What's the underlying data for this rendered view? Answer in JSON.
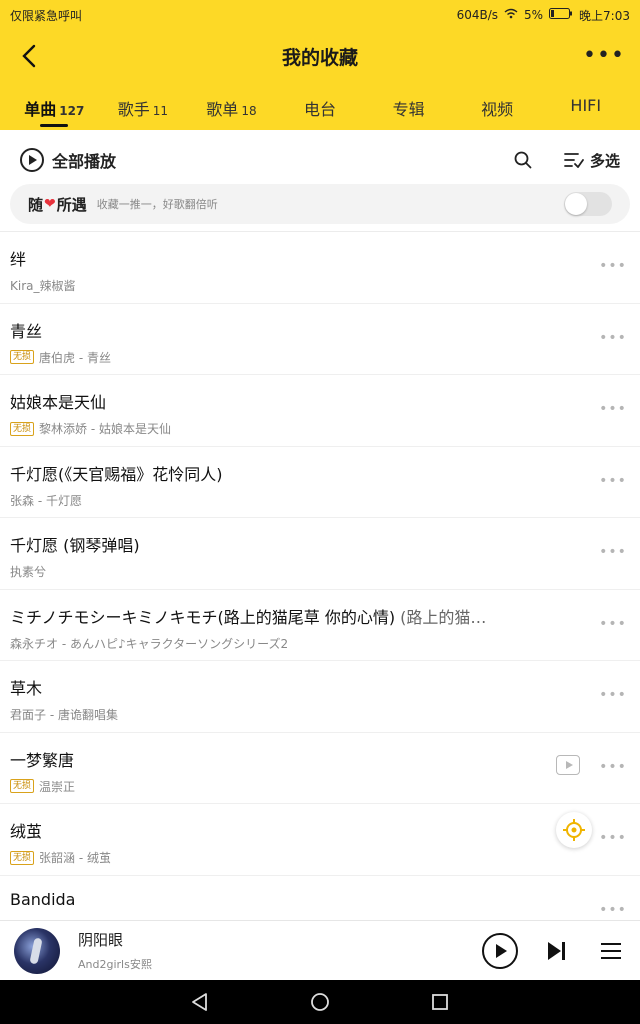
{
  "status_bar": {
    "left_text": "仅限紧急呼叫",
    "speed": "604B/s",
    "battery": "5%",
    "time": "晚上7:03"
  },
  "header": {
    "title": "我的收藏"
  },
  "tabs": [
    {
      "label": "单曲",
      "count": "127",
      "active": true
    },
    {
      "label": "歌手",
      "count": "11"
    },
    {
      "label": "歌单",
      "count": "18"
    },
    {
      "label": "电台",
      "count": ""
    },
    {
      "label": "专辑",
      "count": ""
    },
    {
      "label": "视频",
      "count": ""
    },
    {
      "label": "HIFI",
      "count": ""
    }
  ],
  "toolbar": {
    "play_all": "全部播放",
    "multi_select": "多选"
  },
  "random_bar": {
    "title_pre": "随",
    "title_post": "所遇",
    "description": "收藏一推一，好歌翻倍听",
    "toggle_on": false
  },
  "songs": [
    {
      "title": "绊",
      "subtitle": "",
      "meta": "Kira_辣椒酱",
      "badge": "",
      "mv": false
    },
    {
      "title": "青丝",
      "subtitle": "",
      "meta": "唐伯虎 - 青丝",
      "badge": "无损",
      "mv": false
    },
    {
      "title": "姑娘本是天仙",
      "subtitle": "",
      "meta": "黎林添娇 - 姑娘本是天仙",
      "badge": "无损",
      "mv": false
    },
    {
      "title": "千灯愿(《天官赐福》花怜同人)",
      "subtitle": "",
      "meta": "张森 - 千灯愿",
      "badge": "",
      "mv": false
    },
    {
      "title": "千灯愿 (钢琴弹唱)",
      "subtitle": "",
      "meta": "执素兮",
      "badge": "",
      "mv": false
    },
    {
      "title": "ミチノチモシーキミノキモチ(路上的猫尾草 你的心情)",
      "subtitle": " (路上的猫…",
      "meta": "森永チオ - あんハピ♪キャラクターソングシリーズ2",
      "badge": "",
      "mv": false
    },
    {
      "title": "草木",
      "subtitle": "",
      "meta": "君面子 - 唐诡翻唱集",
      "badge": "",
      "mv": false
    },
    {
      "title": "一梦繁唐",
      "subtitle": "",
      "meta": "温崇正",
      "badge": "无损",
      "mv": true
    },
    {
      "title": "绒茧",
      "subtitle": "",
      "meta": "张韶涵 - 绒茧",
      "badge": "无损",
      "mv": false
    },
    {
      "title": "Bandida",
      "subtitle": "",
      "meta": "",
      "badge": "",
      "mv": false
    }
  ],
  "player": {
    "title": "阴阳眼",
    "artist": "And2girls安熙"
  },
  "colors": {
    "accent": "#fdd926",
    "badge": "#d9a21b",
    "heart": "#e8323c"
  }
}
